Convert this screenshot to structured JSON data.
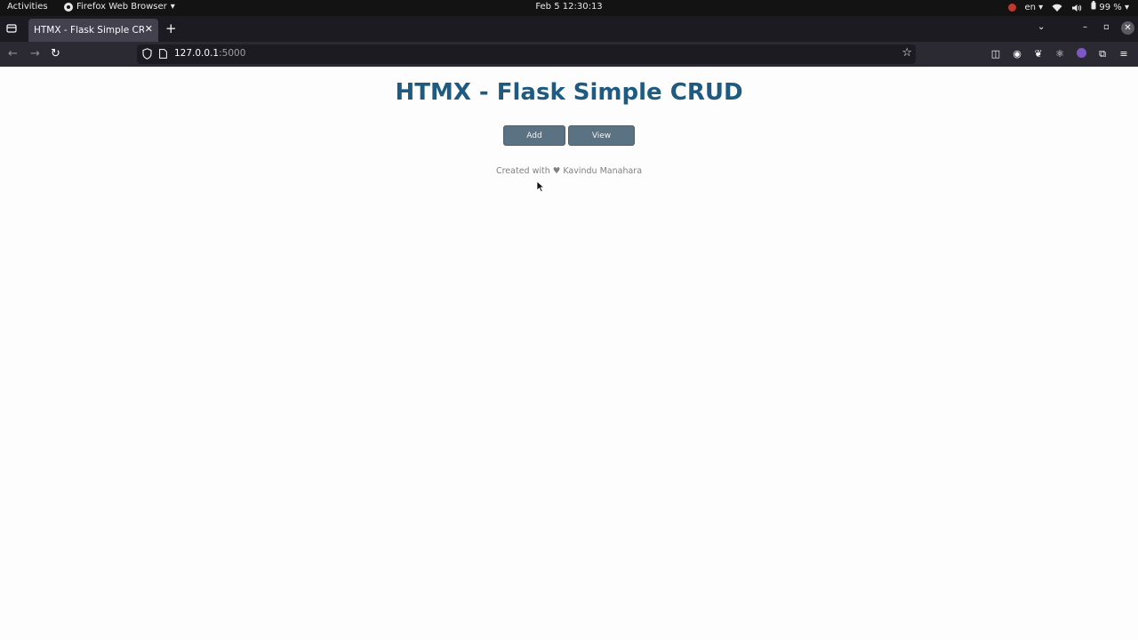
{
  "system_bar": {
    "activities": "Activities",
    "app_name": "Firefox Web Browser",
    "clock": "Feb 5  12:30:13",
    "language": "en",
    "battery": "99 %"
  },
  "browser": {
    "tab_title": "HTMX - Flask Simple CRUD",
    "url_host": "127.0.0.1",
    "url_port": ":5000"
  },
  "page": {
    "title": "HTMX - Flask Simple CRUD",
    "add_label": "Add",
    "view_label": "View",
    "credit_prefix": "Created with",
    "credit_heart": "♥",
    "credit_author": "Kavindu Manahara"
  },
  "colors": {
    "title": "#1f5b80",
    "button_bg": "#5a7281",
    "credit_text": "#808080"
  }
}
